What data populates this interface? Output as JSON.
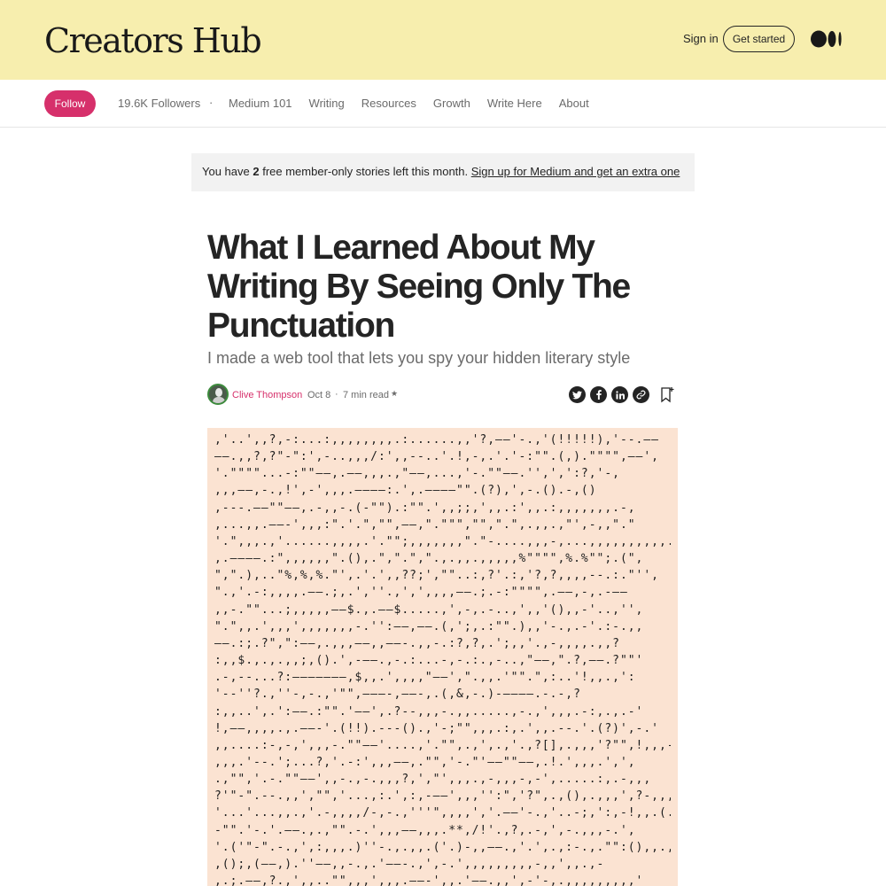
{
  "header": {
    "brand": "Creators Hub",
    "sign_in": "Sign in",
    "get_started": "Get started"
  },
  "nav": {
    "follow": "Follow",
    "followers": "19.6K Followers",
    "separator": "·",
    "links": [
      "Medium 101",
      "Writing",
      "Resources",
      "Growth",
      "Write Here",
      "About"
    ]
  },
  "banner": {
    "prefix": "You have ",
    "count": "2",
    "middle": " free member-only stories left this month. ",
    "link": "Sign up for Medium and get an extra one"
  },
  "article": {
    "title": "What I Learned About My Writing By Seeing Only The Punctuation",
    "subtitle": "I made a web tool that lets you spy your hidden literary style",
    "author": "Clive Thompson",
    "date": "Oct 8",
    "separator": "·",
    "read_time": "7 min read",
    "star": "★",
    "social": [
      "t",
      "f",
      "in",
      "🔗"
    ]
  },
  "punctuation_lines": [
    ",'..',,?,-:...:,,,,,,,,.:......,,'?,——'-.,'(!!!!!),'--.——",
    "——.,,?,?\"-\":',-..,,,/:',,--..'.!,-,.'.'-:\"\".(,).\"\"\"\",——',",
    "'.\"\"\"\"...-:\"\"——,.——,,,.,\"——,...,'-.\"\"——.'',',':?,'-,",
    ",,,——,-.,!',-',,,.————:.',.————\"\".(?),',-.().-,()",
    ",---.——\"\"——,.-,,-.(-\"\").:\"\".',,;;,',,.:',,.:,,,,,,,.-,",
    ",...,,.——-',,,:\".'.\",\"\",——,\".\"\"\",\"\",\".\",.,,.,\"',-,,\".\"",
    "'.\",,,.,'......,,,,.'.\"\";,,,,,,,\".\"-....,,,-,...,,,,,,,,,,.',",
    ",.————.:\",,,,,,\".(),.\",\".\",\".,.,,.,,,,,%\"\"\"\",%.%\"\";.(\",",
    "\",\".),..\"%,%,%.\"',.'.',,??;',\"\"..:,?'.:,'?,?,,,,--.:.\"'',",
    "\".,'.-:,,,,.——.;,.',''.,',',,,,——.;.-:\"\"\"\",.——,-,.-——",
    ",,-.\"\"...;,,,,,——$.,.——$.....,',-,.-..,',,'(),,-'..,'',",
    "\".\",,.',,,',,,,,,,-.'':——,——.(,';,.:\"\".),,'-.,.-'.:-.,,",
    "——.:;.?\",\":——,.,,,——,,——-.,,-.:?,?,.';,,'.,-,,,,.,,?",
    ":,,$.,.,.,,;,().',-——.,-.:...-,-.:.,-..,\"——,\".?,——.?\"\"'",
    ".-,--...?:———————,$,,.',,,,\"——',\".,,.'\"\".\",:..'!,,.,':",
    "'--''?.,''-,-.,'\"\",———-,——-,.(,&,-.)-————.-.-,?",
    ":,,..',.':——.:\"\".'——',.?--,,,-.,,.....,-.,',,,.-:,.,.-'",
    "!,——,,,,.,.——-'.(!!).---().,'-;\"\",,,.:,.',,.--.'.(?)',-.'",
    ",,....:-,-,',,,-.\"\"——'....,'.\"\",.,',.,'.,?[],.,,,'?\"\",!,,,-'",
    ",,,.'--.';...?,'.-:',,,——,.\"\",'-.\"'——\"\"——,.!.',,,.',',",
    ".,\"\",'.-.\"\"——',,-.,-.,,,?,',\"',,,.,-,,,-,-',.....:,.-,,,",
    "?'\"-\".--.,,',\"\",'...,:.',:,-——',,,'':\",'?\",.,(),.,,,',?-,,,",
    "'...'...,,.,'.-,,,,/-,-.,'''\",,,,','.——'-.,'..-;,':,-!,,.(.)",
    "-\"\".'-.'.——.,.,\"\".-.',,,——,,,.**,/!'.,?,.-,',-.,,,-.',",
    "'.('\"-\".-.,',:,,,.)''-.,.,,.('.)-,,——.,'.',.,:-.,.\"\":(),,.,;!,",
    ",();,(——,).''——,,-.,.'——-.,',-.',,,,,,,,,-,,',,.,-",
    ",.;.——,?.,',,..\"\",,,',,,.——-',,.'——.,,',-'-,.,,,,,,,,,'"
  ]
}
